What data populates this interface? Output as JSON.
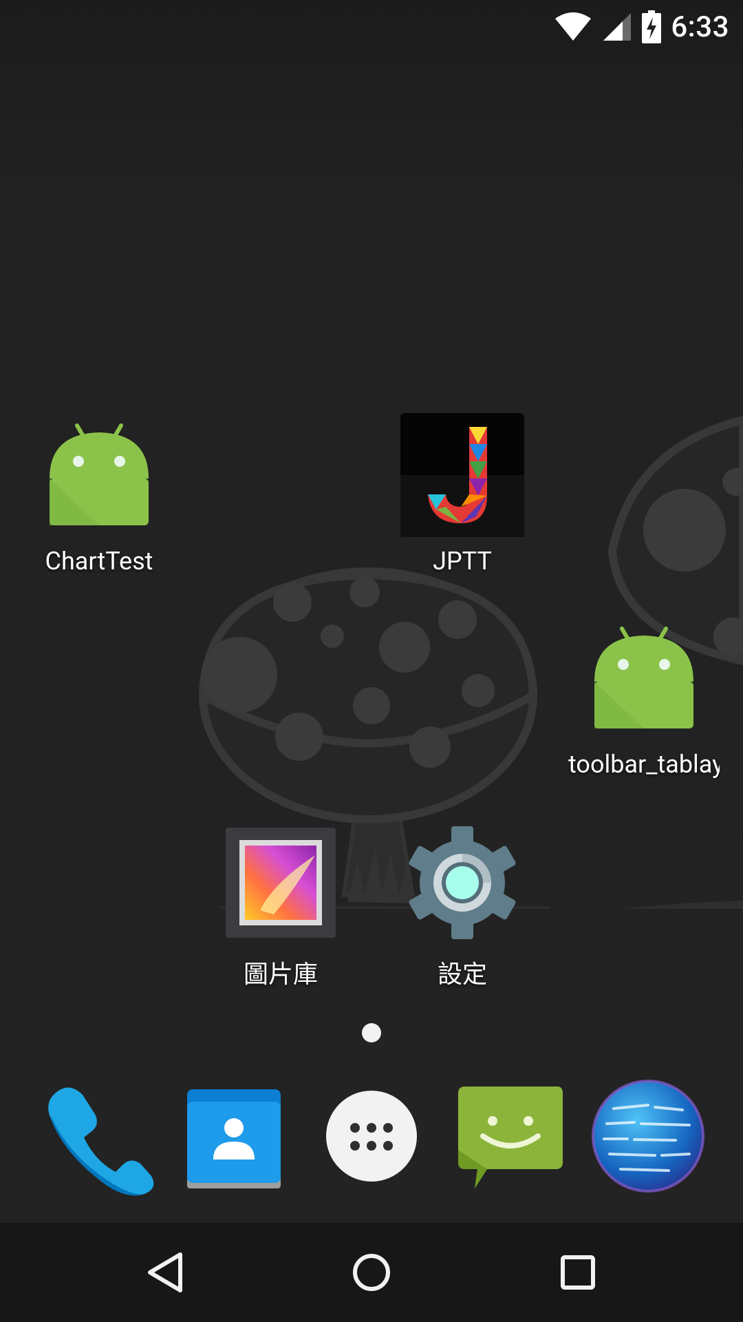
{
  "status_bar": {
    "time": "6:33",
    "icons": [
      "wifi-icon",
      "cell-signal-icon",
      "battery-charging-icon"
    ]
  },
  "home": {
    "apps": [
      {
        "label": "ChartTest",
        "icon": "android-robot-icon"
      },
      {
        "label": "JPTT",
        "icon": "jptt-icon"
      },
      {
        "label": "toolbar_tablay..",
        "icon": "android-robot-icon"
      },
      {
        "label": "圖片庫",
        "icon": "gallery-icon"
      },
      {
        "label": "設定",
        "icon": "settings-gear-icon"
      }
    ],
    "current_page": 1
  },
  "dock": {
    "items": [
      "phone-icon",
      "contacts-icon",
      "app-drawer-icon",
      "messaging-icon",
      "browser-globe-icon"
    ]
  },
  "nav_bar": {
    "buttons": [
      "back-icon",
      "home-icon",
      "recents-icon"
    ]
  },
  "colors": {
    "background": "#222222",
    "android_green": "#8BC34A",
    "phone_blue": "#1EA7E4",
    "messaging_green": "#8CB43A"
  }
}
